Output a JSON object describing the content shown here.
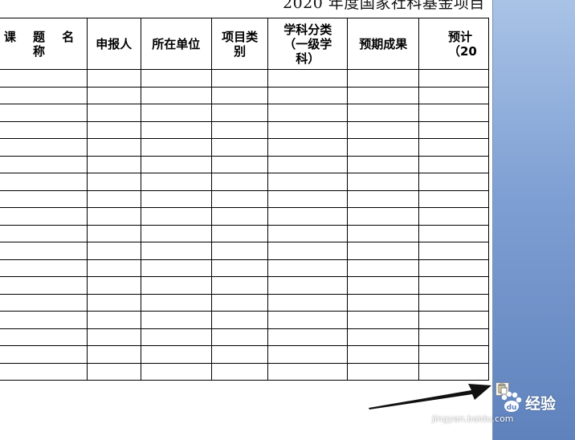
{
  "document": {
    "title": "2020 年度国家社科基金项目"
  },
  "table": {
    "headers": [
      {
        "id": "topic",
        "label": "课 题 名 称"
      },
      {
        "id": "applicant",
        "label": "申报人"
      },
      {
        "id": "unit",
        "label": "所在单位"
      },
      {
        "id": "project_type",
        "label": "项目类别"
      },
      {
        "id": "discipline",
        "label": "学科分类（一级学科）"
      },
      {
        "id": "expected",
        "label": "预期成果"
      },
      {
        "id": "deadline",
        "label": "预计（20"
      }
    ],
    "row_count": 18
  },
  "watermark": {
    "brand": "经验",
    "url": "jingyan.baidu.com"
  },
  "colors": {
    "sidebar_top": "#a9c3e6",
    "sidebar_bottom": "#5f82bd",
    "grid_line": "#000000"
  },
  "icons": {
    "paste_options": "paste-options-icon",
    "arrow": "arrow-annotation-icon",
    "baidu_logo": "baidu-paw-logo"
  }
}
